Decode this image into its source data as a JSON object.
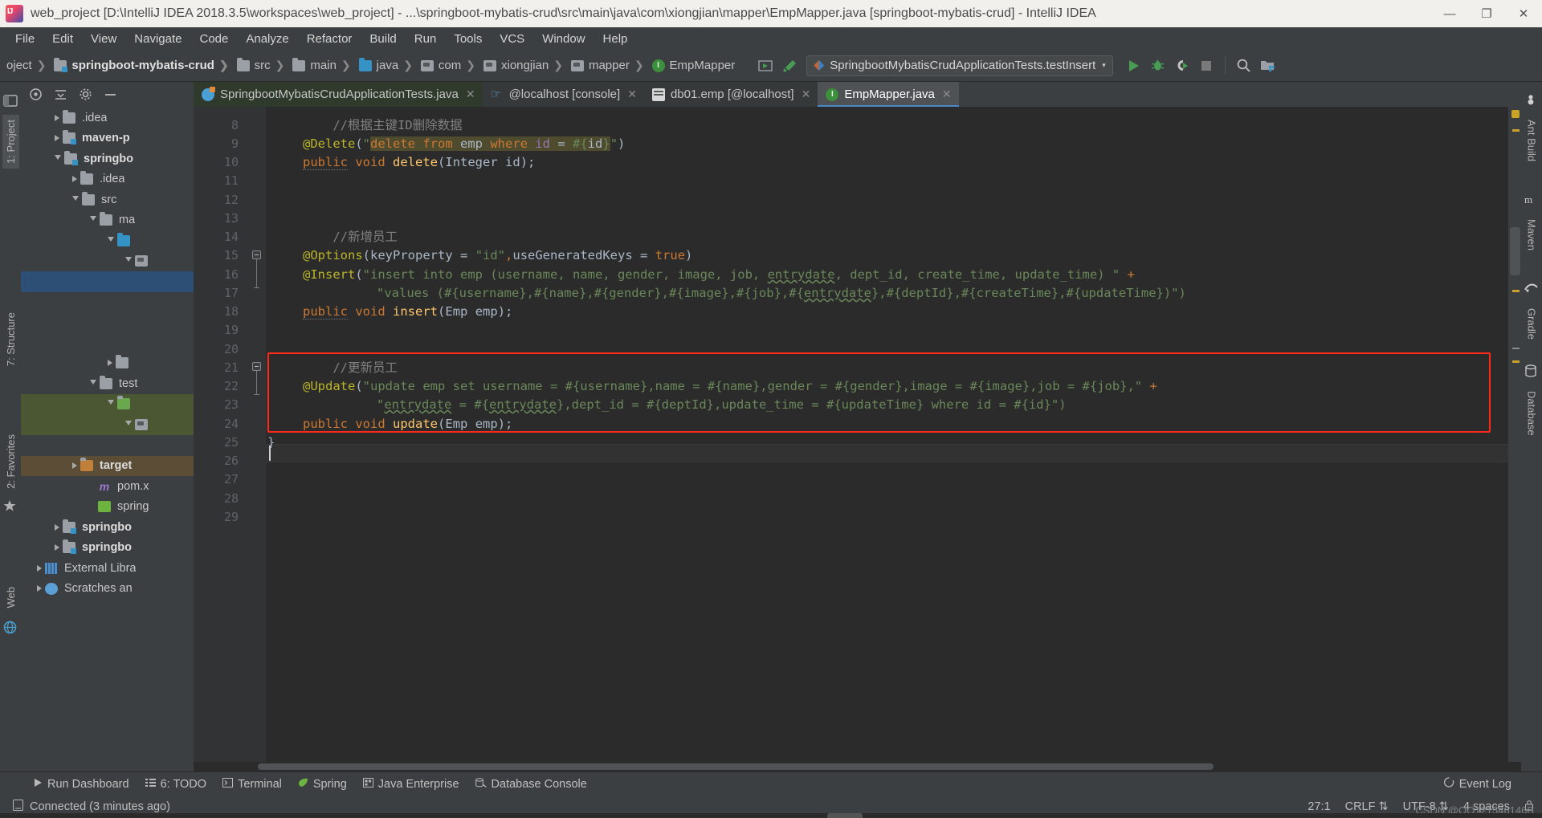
{
  "window": {
    "title": "web_project [D:\\IntelliJ IDEA 2018.3.5\\workspaces\\web_project] - ...\\springboot-mybatis-crud\\src\\main\\java\\com\\xiongjian\\mapper\\EmpMapper.java [springboot-mybatis-crud] - IntelliJ IDEA",
    "logo": "intellij-idea-logo",
    "minimize": "—",
    "maximize": "❐",
    "close": "✕"
  },
  "menu": [
    "File",
    "Edit",
    "View",
    "Navigate",
    "Code",
    "Analyze",
    "Refactor",
    "Build",
    "Run",
    "Tools",
    "VCS",
    "Window",
    "Help"
  ],
  "breadcrumbs": [
    {
      "label": "oject",
      "icon": "project-icon",
      "bold": false
    },
    {
      "label": "springboot-mybatis-crud",
      "icon": "module-icon",
      "bold": true
    },
    {
      "label": "src",
      "icon": "folder-icon",
      "bold": false
    },
    {
      "label": "main",
      "icon": "folder-icon",
      "bold": false
    },
    {
      "label": "java",
      "icon": "source-folder-icon",
      "bold": false
    },
    {
      "label": "com",
      "icon": "package-icon",
      "bold": false
    },
    {
      "label": "xiongjian",
      "icon": "package-icon",
      "bold": false
    },
    {
      "label": "mapper",
      "icon": "package-icon",
      "bold": false
    },
    {
      "label": "EmpMapper",
      "icon": "interface-icon",
      "bold": false
    }
  ],
  "toolbar": {
    "run_config": "SpringbootMybatisCrudApplicationTests.testInsert",
    "run_config_arrow": "▾",
    "icons": [
      "run-anything-icon",
      "build-hammer-icon",
      "run-icon",
      "debug-icon",
      "run-coverage-icon",
      "stop-icon",
      "search-everywhere-icon",
      "project-structure-icon"
    ]
  },
  "project_tree": [
    {
      "label": ".idea",
      "indent": 1,
      "arrow": "right",
      "icon": "folder-icon",
      "state": "none"
    },
    {
      "label": "maven-p",
      "indent": 1,
      "arrow": "right",
      "icon": "folder-icon",
      "state": "none",
      "bold": true
    },
    {
      "label": "springbo",
      "indent": 1,
      "arrow": "down",
      "icon": "module-icon",
      "state": "none",
      "bold": true
    },
    {
      "label": ".idea",
      "indent": 2,
      "arrow": "right",
      "icon": "folder-icon",
      "state": "none"
    },
    {
      "label": "src",
      "indent": 2,
      "arrow": "down",
      "icon": "folder-icon",
      "state": "none"
    },
    {
      "label": "ma",
      "indent": 3,
      "arrow": "down",
      "icon": "folder-icon",
      "state": "none"
    },
    {
      "label": "",
      "indent": 4,
      "arrow": "down",
      "icon": "source-folder-icon",
      "state": "none"
    },
    {
      "label": "",
      "indent": 5,
      "arrow": "down",
      "icon": "package-icon",
      "state": "none"
    },
    {
      "label": "",
      "indent": 5,
      "arrow": "none",
      "icon": "package-icon",
      "state": "selected-blue"
    },
    {
      "label": "",
      "indent": 4,
      "arrow": "right",
      "icon": "folder-icon",
      "state": "none"
    },
    {
      "label": "test",
      "indent": 3,
      "arrow": "down",
      "icon": "folder-icon",
      "state": "none"
    },
    {
      "label": "",
      "indent": 4,
      "arrow": "down",
      "icon": "source-folder-icon",
      "state": "selected-green"
    },
    {
      "label": "",
      "indent": 5,
      "arrow": "down",
      "icon": "package-icon",
      "state": "selected-green"
    },
    {
      "label": "target",
      "indent": 3,
      "arrow": "right",
      "icon": "folder-icon",
      "state": "selected-brown"
    },
    {
      "label": "pom.x",
      "indent": 3,
      "arrow": "none",
      "icon": "maven-file-icon",
      "state": "none"
    },
    {
      "label": "spring",
      "indent": 3,
      "arrow": "none",
      "icon": "spring-file-icon",
      "state": "none"
    },
    {
      "label": "springbo",
      "indent": 1,
      "arrow": "right",
      "icon": "module-icon",
      "state": "none",
      "bold": true
    },
    {
      "label": "springbo",
      "indent": 1,
      "arrow": "right",
      "icon": "module-icon",
      "state": "none",
      "bold": true
    },
    {
      "label": "External Libra",
      "indent": 0,
      "arrow": "right",
      "icon": "library-icon",
      "state": "none"
    },
    {
      "label": "Scratches an",
      "indent": 0,
      "arrow": "right",
      "icon": "scratches-icon",
      "state": "none"
    }
  ],
  "left_strip": [
    "1: Project",
    "7: Structure",
    "2: Favorites"
  ],
  "right_strip": [
    "Ant Build",
    "Maven",
    "Gradle",
    "Database"
  ],
  "editor_tabs": [
    {
      "label": "SpringbootMybatisCrudApplicationTests.java",
      "icon": "java-class-icon",
      "style": "green",
      "active": false,
      "close": "✕"
    },
    {
      "label": "@localhost [console]",
      "icon": "console-icon",
      "style": "dark",
      "active": false,
      "close": "✕"
    },
    {
      "label": "db01.emp [@localhost]",
      "icon": "db-table-icon",
      "style": "dark",
      "active": false,
      "close": "✕"
    },
    {
      "label": "EmpMapper.java",
      "icon": "interface-icon",
      "style": "dark",
      "active": true,
      "close": "✕"
    }
  ],
  "code": {
    "first_line_number": 8,
    "line_numbers": [
      8,
      9,
      10,
      11,
      12,
      13,
      14,
      15,
      16,
      17,
      18,
      19,
      20,
      21,
      22,
      23,
      24,
      25,
      26,
      27,
      28,
      29
    ],
    "lines": [
      "",
      "    //根据主键ID删除数据",
      "    @Delete(\"delete from emp where id = #{id}\")",
      "    public void delete(Integer id);",
      "",
      "",
      "",
      "    //新增员工",
      "    @Options(keyProperty = \"id\",useGeneratedKeys = true)",
      "    @Insert(\"insert into emp (username, name, gender, image, job, entrydate, dept_id, create_time, update_time) \" +",
      "            \"values (#{username},#{name},#{gender},#{image},#{job},#{entrydate},#{deptId},#{createTime},#{updateTime})\")",
      "    public void insert(Emp emp);",
      "",
      "",
      "    //更新员工",
      "    @Update(\"update emp set username = #{username},name = #{name},gender = #{gender},image = #{image},job = #{job},\" +",
      "            \"entrydate = #{entrydate},dept_id = #{deptId},update_time = #{updateTime} where id = #{id}\")",
      "    public void update(Emp emp);",
      "}",
      "",
      "",
      ""
    ],
    "highlight_box_label": "update-method-highlight",
    "highlight_box_color": "#fc2a18"
  },
  "bottom_bar": [
    {
      "label": "Run Dashboard",
      "icon": "run-dashboard-icon"
    },
    {
      "label": "6: TODO",
      "icon": "todo-icon"
    },
    {
      "label": "Terminal",
      "icon": "terminal-icon"
    },
    {
      "label": "Spring",
      "icon": "spring-leaf-icon"
    },
    {
      "label": "Java Enterprise",
      "icon": "java-enterprise-icon"
    },
    {
      "label": "Database Console",
      "icon": "database-console-icon"
    }
  ],
  "bottom_bar_right": {
    "label": "Event Log",
    "icon": "event-log-icon"
  },
  "status_bar": {
    "connection": "Connected (3 minutes ago)",
    "connection_icon": "db-connection-icon",
    "caret_position": "27:1",
    "line_separator": "CRLF",
    "line_separator_arrow": "⇅",
    "encoding": "UTF-8",
    "encoding_arrow": "⇅",
    "indent": "4 spaces",
    "lock_icon": "lock-icon",
    "watermark": "CSDN @QQ121546146B"
  },
  "colors": {
    "accent_blue": "#4a88c7",
    "annotation": "#bbb529",
    "keyword": "#cc7832",
    "string": "#6a8759",
    "comment": "#808080",
    "method": "#ffc66d",
    "field": "#9876aa",
    "editor_bg": "#2b2b2b",
    "panel_bg": "#3c3f41",
    "highlight_red": "#fc2a18"
  }
}
